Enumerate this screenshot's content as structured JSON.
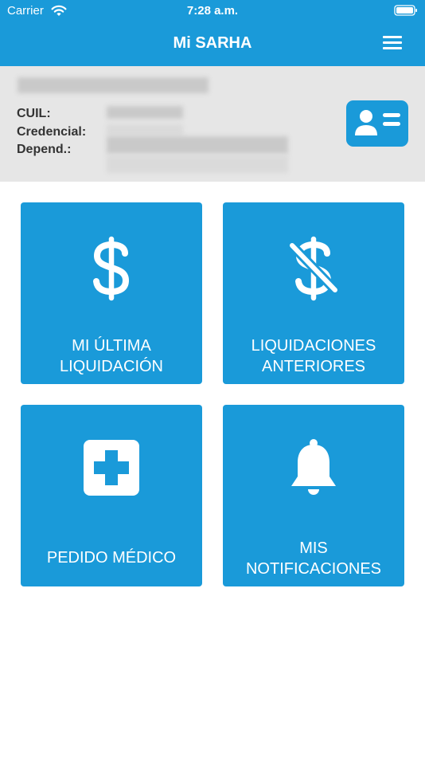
{
  "status_bar": {
    "carrier": "Carrier",
    "time": "7:28 a.m.",
    "wifi_icon": "wifi-icon",
    "battery_icon": "battery-icon"
  },
  "header": {
    "title": "Mi SARHA",
    "menu_icon": "hamburger-menu-icon"
  },
  "profile": {
    "cuil_label": "CUIL:",
    "credencial_label": "Credencial:",
    "depend_label": "Depend.:",
    "card_icon": "id-card-icon"
  },
  "tiles": [
    {
      "label": "MI ÚLTIMA\nLIQUIDACIÓN",
      "icon": "dollar-icon"
    },
    {
      "label": "LIQUIDACIONES\nANTERIORES",
      "icon": "dollar-slash-icon"
    },
    {
      "label": "PEDIDO MÉDICO",
      "icon": "medical-cross-icon"
    },
    {
      "label": "MIS\nNOTIFICACIONES",
      "icon": "bell-icon"
    }
  ],
  "colors": {
    "primary": "#1a9ad9",
    "profile_background": "#e6e6e6",
    "label_text": "#333333"
  }
}
